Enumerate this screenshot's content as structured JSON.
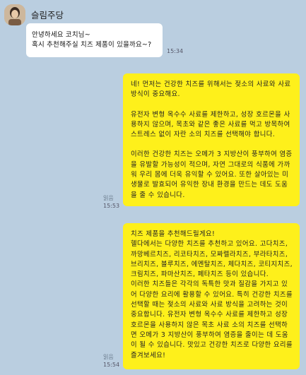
{
  "chat": {
    "sender_name": "슬림주당",
    "incoming": {
      "text": "안녕하세요 코치님~\n혹시 추천해주실 치즈 제품이 있을까요~?",
      "time": "15:34"
    },
    "outgoing": [
      {
        "paragraphs": [
          "네! 먼저는 건강한 치즈를 위해서는 젖소의 사료와 사료 방식이 중요해요.",
          "유전자 변형 옥수수 사료를 제한하고, 성장 호르몬을 사용하지 않으며, 목초와 같은 좋은 사료를 먹고 방목하여 스트레스 없이 자란 소의 치즈를 선택해야 합니다.",
          "이러한 건강한 치즈는 오메가 3 지방산이 풍부하여 염증을 유발할 가능성이 적으며, 자연 그대로의 식품에 가까워 우리 몸에 더욱 유익할 수 있어요. 또한 살아있는 미생물로 발효되어 유익한 장내 환경을 만드는 데도 도움을 줄 수 있습니다."
        ],
        "read_label": "읽음",
        "time": "15:53"
      },
      {
        "paragraphs": [
          "치즈 제품을 추천해드릴게요!\n헬다에서는 다양한 치즈를 추천하고 있어요. 고다치즈, 까망베르치즈, 리코타치즈, 모짜렐라치즈, 부라타치즈, 브리치즈, 블루치즈, 에멘탈치즈, 체다치즈, 코티지치즈, 크림치즈, 파마산치즈, 페타치즈 등이 있습니다.\n이러한 치즈들은 각각의 독특한 맛과 질감을 가지고 있어 다양한 요리에 활용할 수 있어요. 특히 건강한 치즈를 선택할 때는 젖소의 사료와 사료 방식을 고려하는 것이 중요합니다. 유전자 변형 옥수수 사료를 제한하고 성장 호르몬을 사용하지 않은 목초 사료 소의 치즈를 선택하면 오메가 3 지방산이 풍부하여 염증을 줄이는 데 도움이 될 수 있습니다. 맛있고 건강한 치즈로 다양한 요리를 즐겨보세요!"
        ],
        "read_label": "읽음",
        "time": "15:54"
      }
    ]
  }
}
